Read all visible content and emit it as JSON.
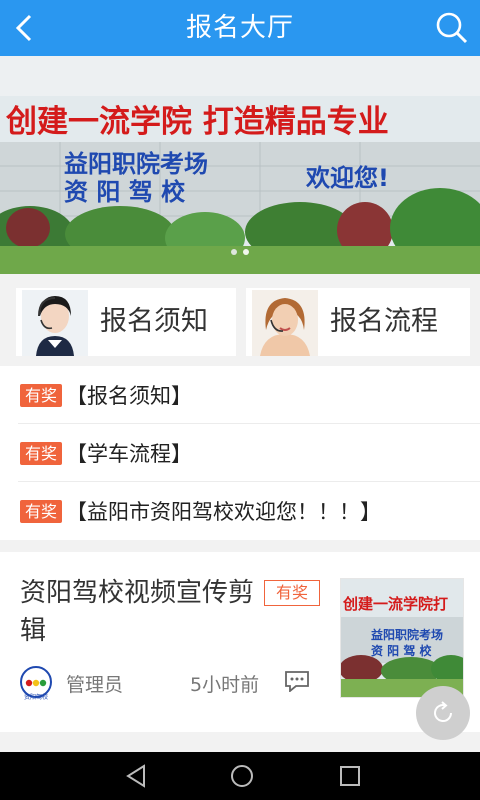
{
  "header": {
    "title": "报名大厅",
    "back_icon": "back-arrow-icon",
    "search_icon": "search-icon",
    "bg_color": "#2a97f0"
  },
  "banner": {
    "slogan": "创建一流学院 打造精品专业",
    "sign_line1": "益阳职院考场",
    "sign_line2": "资  阳  驾  校",
    "sign_line3": "欢迎您!",
    "dots_total": 2,
    "dot_active": 2
  },
  "quick_entries": [
    {
      "label": "报名须知",
      "icon": "headset-agent-avatar"
    },
    {
      "label": "报名流程",
      "icon": "headset-agent-avatar"
    }
  ],
  "notices": [
    {
      "tag": "有奖",
      "text": "【报名须知】"
    },
    {
      "tag": "有奖",
      "text": "【学车流程】"
    },
    {
      "tag": "有奖",
      "text": "【益阳市资阳驾校欢迎您！！！】"
    }
  ],
  "feed_item": {
    "title": "资阳驾校视频宣传剪辑",
    "tag": "有奖",
    "author": "管理员",
    "time": "5小时前",
    "thumb_slogan": "创建一流学院打",
    "thumb_sign1": "益阳职院考场",
    "thumb_sign2": "资 阳 驾 校",
    "logo_text": "资阳驾校"
  },
  "fab": {
    "icon": "refresh-icon"
  },
  "nav_bar": {
    "back": "nav-back-icon",
    "home": "nav-home-icon",
    "recent": "nav-recent-icon"
  },
  "colors": {
    "accent": "#2a97f0",
    "tag": "#f0643c"
  }
}
